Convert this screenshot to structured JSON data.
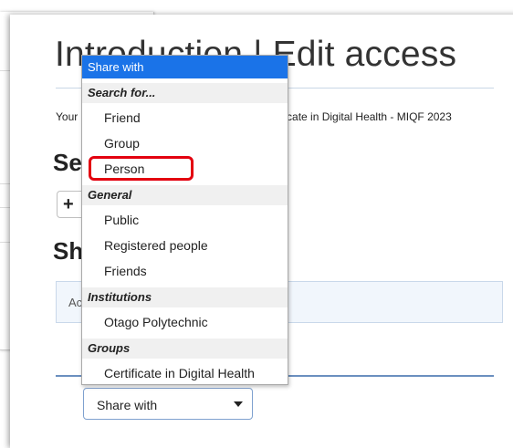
{
  "page": {
    "title": "Introduction | Edit access",
    "intro_text": "Your page Introduction is in the collection Certificate in Digital Health - MIQF 2023",
    "section1_heading": "Se",
    "add_button_icon": "plus-icon",
    "section2_heading": "Sh",
    "info_box_text": "Ac"
  },
  "share_select": {
    "value": "Share with",
    "caret_icon": "caret-down-icon"
  },
  "dropdown": {
    "header": "Share with",
    "groups": [
      {
        "label": "Search for...",
        "options": [
          "Friend",
          "Group",
          "Person"
        ]
      },
      {
        "label": "General",
        "options": [
          "Public",
          "Registered people",
          "Friends"
        ]
      },
      {
        "label": "Institutions",
        "options": [
          "Otago Polytechnic"
        ]
      },
      {
        "label": "Groups",
        "options": [
          "Certificate in Digital Health"
        ]
      }
    ],
    "highlighted_option": "Person",
    "highlight_color": "#e3000f",
    "header_color": "#1a73e8"
  }
}
